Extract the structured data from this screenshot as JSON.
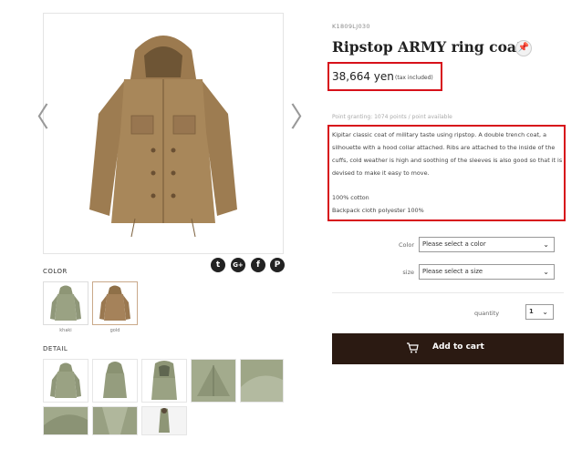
{
  "product": {
    "sku": "K1809LJ030",
    "title": "Ripstop ARMY ring coat",
    "price": "38,664 yen",
    "tax_note": "(tax included)",
    "points": "Point granting: 1074 points / point available",
    "description": "Kipitar classic coat of military taste using ripstop. A double trench coat, a silhouette with a hood collar attached. Ribs are attached to the inside of the cuffs, cold weather is high and soothing of the sleeves is also good so that it is devised to make it easy to move.",
    "material_1": "100% cotton",
    "material_2": "Backpack cloth polyester 100%"
  },
  "gallery": {
    "prev_arrow": "〈",
    "next_arrow": "〉",
    "main_color": "#a8875a"
  },
  "share": {
    "twitter": "t",
    "google": "G+",
    "facebook": "f",
    "pinterest": "P"
  },
  "color_section": {
    "label": "COLOR",
    "swatches": [
      {
        "name": "khaki",
        "color": "#9aa283"
      },
      {
        "name": "gold",
        "color": "#a5825a"
      }
    ]
  },
  "detail_section": {
    "label": "DETAIL"
  },
  "options": {
    "color_label": "Color",
    "color_placeholder": "Please select a color",
    "size_label": "size",
    "size_placeholder": "Please select a size"
  },
  "quantity": {
    "label": "quantity",
    "value": "1"
  },
  "cart": {
    "label": "Add to cart"
  }
}
